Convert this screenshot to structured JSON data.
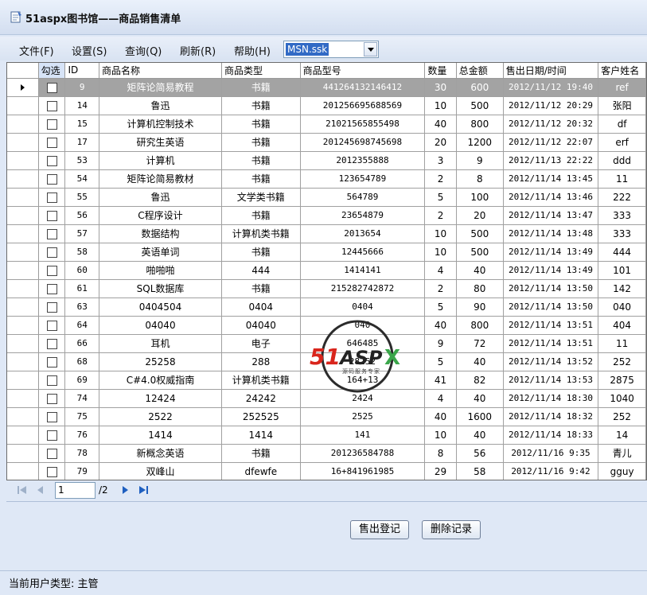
{
  "window": {
    "title": "51aspx图书馆——商品销售清单"
  },
  "menu": {
    "items": [
      "文件(F)",
      "设置(S)",
      "查询(Q)",
      "刷新(R)",
      "帮助(H)"
    ],
    "combo_value": "MSN.ssk"
  },
  "grid": {
    "columns": [
      "勾选",
      "ID",
      "商品名称",
      "商品类型",
      "商品型号",
      "数量",
      "总金额",
      "售出日期/时间",
      "客户姓名"
    ],
    "selected_row_index": 0,
    "rows": [
      [
        "9",
        "矩阵论简易教程",
        "书籍",
        "441264132146412",
        "30",
        "600",
        "2012/11/12 19:40",
        "ref"
      ],
      [
        "14",
        "鲁迅",
        "书籍",
        "201256695688569",
        "10",
        "500",
        "2012/11/12 20:29",
        "张阳"
      ],
      [
        "15",
        "计算机控制技术",
        "书籍",
        "21021565855498",
        "40",
        "800",
        "2012/11/12 20:32",
        "df"
      ],
      [
        "17",
        "研究生英语",
        "书籍",
        "201245698745698",
        "20",
        "1200",
        "2012/11/12 22:07",
        "erf"
      ],
      [
        "53",
        "计算机",
        "书籍",
        "2012355888",
        "3",
        "9",
        "2012/11/13 22:22",
        "ddd"
      ],
      [
        "54",
        "矩阵论简易教材",
        "书籍",
        "123654789",
        "2",
        "8",
        "2012/11/14 13:45",
        "11"
      ],
      [
        "55",
        "鲁迅",
        "文学类书籍",
        "564789",
        "5",
        "100",
        "2012/11/14 13:46",
        "222"
      ],
      [
        "56",
        "C程序设计",
        "书籍",
        "23654879",
        "2",
        "20",
        "2012/11/14 13:47",
        "333"
      ],
      [
        "57",
        "数据结构",
        "计算机类书籍",
        "2013654",
        "10",
        "500",
        "2012/11/14 13:48",
        "333"
      ],
      [
        "58",
        "英语单词",
        "书籍",
        "12445666",
        "10",
        "500",
        "2012/11/14 13:49",
        "444"
      ],
      [
        "60",
        "啪啪啪",
        "444",
        "1414141",
        "4",
        "40",
        "2012/11/14 13:49",
        "101"
      ],
      [
        "61",
        "SQL数据库",
        "书籍",
        "215282742872",
        "2",
        "80",
        "2012/11/14 13:50",
        "142"
      ],
      [
        "63",
        "0404504",
        "0404",
        "0404",
        "5",
        "90",
        "2012/11/14 13:50",
        "040"
      ],
      [
        "64",
        "04040",
        "04040",
        "040",
        "40",
        "800",
        "2012/11/14 13:51",
        "404"
      ],
      [
        "66",
        "耳机",
        "电子",
        "646485",
        "9",
        "72",
        "2012/11/14 13:51",
        "11"
      ],
      [
        "68",
        "25258",
        "288",
        "28252",
        "5",
        "40",
        "2012/11/14 13:52",
        "252"
      ],
      [
        "69",
        "C#4.0权威指南",
        "计算机类书籍",
        "164+13",
        "41",
        "82",
        "2012/11/14 13:53",
        "2875"
      ],
      [
        "74",
        "12424",
        "24242",
        "2424",
        "4",
        "40",
        "2012/11/14 18:30",
        "1040"
      ],
      [
        "75",
        "2522",
        "252525",
        "2525",
        "40",
        "1600",
        "2012/11/14 18:32",
        "252"
      ],
      [
        "76",
        "1414",
        "1414",
        "141",
        "10",
        "40",
        "2012/11/14 18:33",
        "14"
      ],
      [
        "78",
        "新概念英语",
        "书籍",
        "201236584788",
        "8",
        "56",
        "2012/11/16 9:35",
        "青儿"
      ],
      [
        "79",
        "双峰山",
        "dfewfe",
        "16+841961985",
        "29",
        "58",
        "2012/11/16 9:42",
        "gguy"
      ]
    ]
  },
  "pager": {
    "current_page": "1",
    "total_label": "/2"
  },
  "actions": {
    "sell_label": "售出登记",
    "delete_label": "删除记录"
  },
  "status": {
    "text": "当前用户类型: 主管"
  },
  "watermark": {
    "brand": "51ASPX",
    "tagline": "源码服务专家"
  },
  "colors": {
    "selected_row": "#a3a3a3",
    "combo_highlight": "#316ac5",
    "background": "#dfe8f6"
  }
}
